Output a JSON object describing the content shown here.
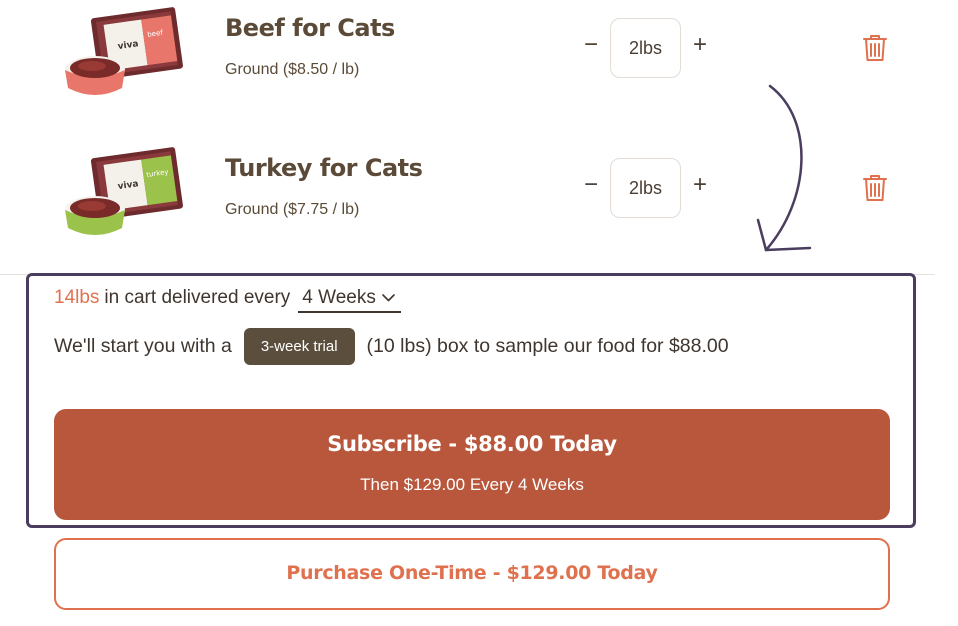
{
  "cart": {
    "items": [
      {
        "name": "Beef for Cats",
        "subtitle": "Ground ($8.50 / lb)",
        "quantity": "2lbs",
        "minus_symbol": "−",
        "plus_symbol": "+",
        "package_brand": "viva",
        "package_flavor": "beef",
        "package_color": "#e8766a",
        "bowl_color": "#e8766a"
      },
      {
        "name": "Turkey for Cats",
        "subtitle": "Ground ($7.75 / lb)",
        "quantity": "2lbs",
        "minus_symbol": "−",
        "plus_symbol": "+",
        "package_brand": "viva",
        "package_flavor": "turkey",
        "package_color": "#9bc24a",
        "bowl_color": "#9bc24a"
      }
    ]
  },
  "subscription": {
    "lbs_in_cart": "14lbs",
    "delivery_text": "in cart delivered every",
    "frequency": "4 Weeks",
    "trial_prefix": "We'll start you with a",
    "trial_badge": "3-week trial",
    "trial_suffix": "(10 lbs) box to sample our food for $88.00",
    "subscribe_label": "Subscribe - $88.00 Today",
    "subscribe_sub": "Then $129.00 Every 4 Weeks",
    "onetime_label": "Purchase One-Time - $129.00 Today"
  },
  "colors": {
    "accent": "#e0714e",
    "subscribe_bg": "#b8573c",
    "badge_bg": "#5b4e3c",
    "highlight_border": "#4a3d5e",
    "text": "#3f362f"
  },
  "icons": {
    "remove": "trash-icon",
    "dropdown": "chevron-down-icon",
    "annotation": "curved-arrow-icon"
  }
}
